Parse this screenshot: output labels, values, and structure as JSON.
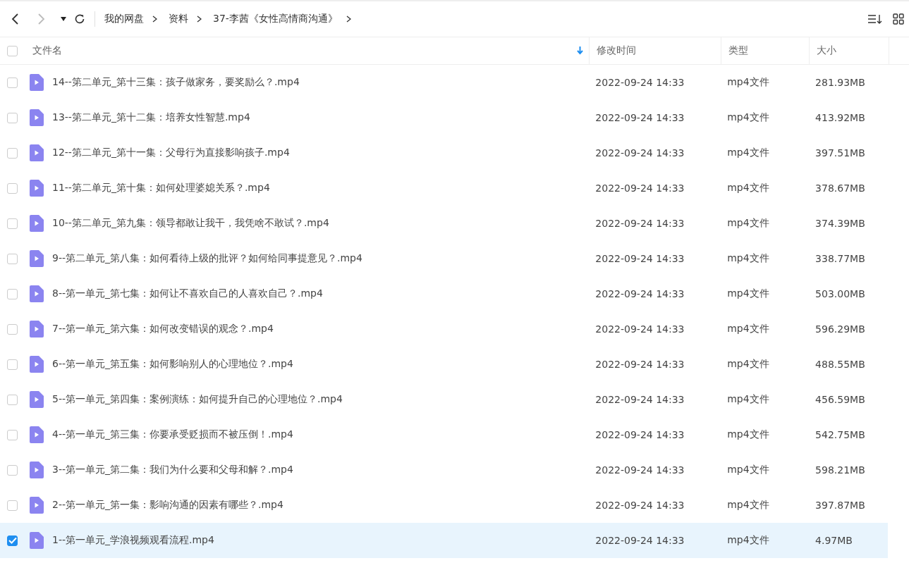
{
  "breadcrumb": [
    {
      "label": "我的网盘"
    },
    {
      "label": "资料"
    },
    {
      "label": "37-李茜《女性高情商沟通》"
    }
  ],
  "header": {
    "checked": false,
    "name_sorted_descending": true,
    "columns": [
      {
        "label": "文件名"
      },
      {
        "label": "修改时间"
      },
      {
        "label": "类型"
      },
      {
        "label": "大小"
      }
    ]
  },
  "rows": [
    {
      "name": "14--第二单元_第十三集：孩子做家务，要奖励么？.mp4",
      "modified": "2022-09-24 14:33",
      "type": "mp4文件",
      "size": "281.93MB",
      "selected": false
    },
    {
      "name": "13--第二单元_第十二集：培养女性智慧.mp4",
      "modified": "2022-09-24 14:33",
      "type": "mp4文件",
      "size": "413.92MB",
      "selected": false
    },
    {
      "name": "12--第二单元_第十一集：父母行为直接影响孩子.mp4",
      "modified": "2022-09-24 14:33",
      "type": "mp4文件",
      "size": "397.51MB",
      "selected": false
    },
    {
      "name": "11--第二单元_第十集：如何处理婆媳关系？.mp4",
      "modified": "2022-09-24 14:33",
      "type": "mp4文件",
      "size": "378.67MB",
      "selected": false
    },
    {
      "name": "10--第二单元_第九集：领导都敢让我干，我凭啥不敢试？.mp4",
      "modified": "2022-09-24 14:33",
      "type": "mp4文件",
      "size": "374.39MB",
      "selected": false
    },
    {
      "name": "9--第二单元_第八集：如何看待上级的批评？如何给同事提意见？.mp4",
      "modified": "2022-09-24 14:33",
      "type": "mp4文件",
      "size": "338.77MB",
      "selected": false
    },
    {
      "name": "8--第一单元_第七集：如何让不喜欢自己的人喜欢自己？.mp4",
      "modified": "2022-09-24 14:33",
      "type": "mp4文件",
      "size": "503.00MB",
      "selected": false
    },
    {
      "name": "7--第一单元_第六集：如何改变错误的观念？.mp4",
      "modified": "2022-09-24 14:33",
      "type": "mp4文件",
      "size": "596.29MB",
      "selected": false
    },
    {
      "name": "6--第一单元_第五集：如何影响别人的心理地位？.mp4",
      "modified": "2022-09-24 14:33",
      "type": "mp4文件",
      "size": "488.55MB",
      "selected": false
    },
    {
      "name": "5--第一单元_第四集：案例演练：如何提升自己的心理地位？.mp4",
      "modified": "2022-09-24 14:33",
      "type": "mp4文件",
      "size": "456.59MB",
      "selected": false
    },
    {
      "name": "4--第一单元_第三集：你要承受贬损而不被压倒！.mp4",
      "modified": "2022-09-24 14:33",
      "type": "mp4文件",
      "size": "542.75MB",
      "selected": false
    },
    {
      "name": "3--第一单元_第二集：我们为什么要和父母和解？.mp4",
      "modified": "2022-09-24 14:33",
      "type": "mp4文件",
      "size": "598.21MB",
      "selected": false
    },
    {
      "name": "2--第一单元_第一集：影响沟通的因素有哪些？.mp4",
      "modified": "2022-09-24 14:33",
      "type": "mp4文件",
      "size": "397.87MB",
      "selected": false
    },
    {
      "name": "1--第一单元_学浪视频观看流程.mp4",
      "modified": "2022-09-24 14:33",
      "type": "mp4文件",
      "size": "4.97MB",
      "selected": true
    }
  ]
}
